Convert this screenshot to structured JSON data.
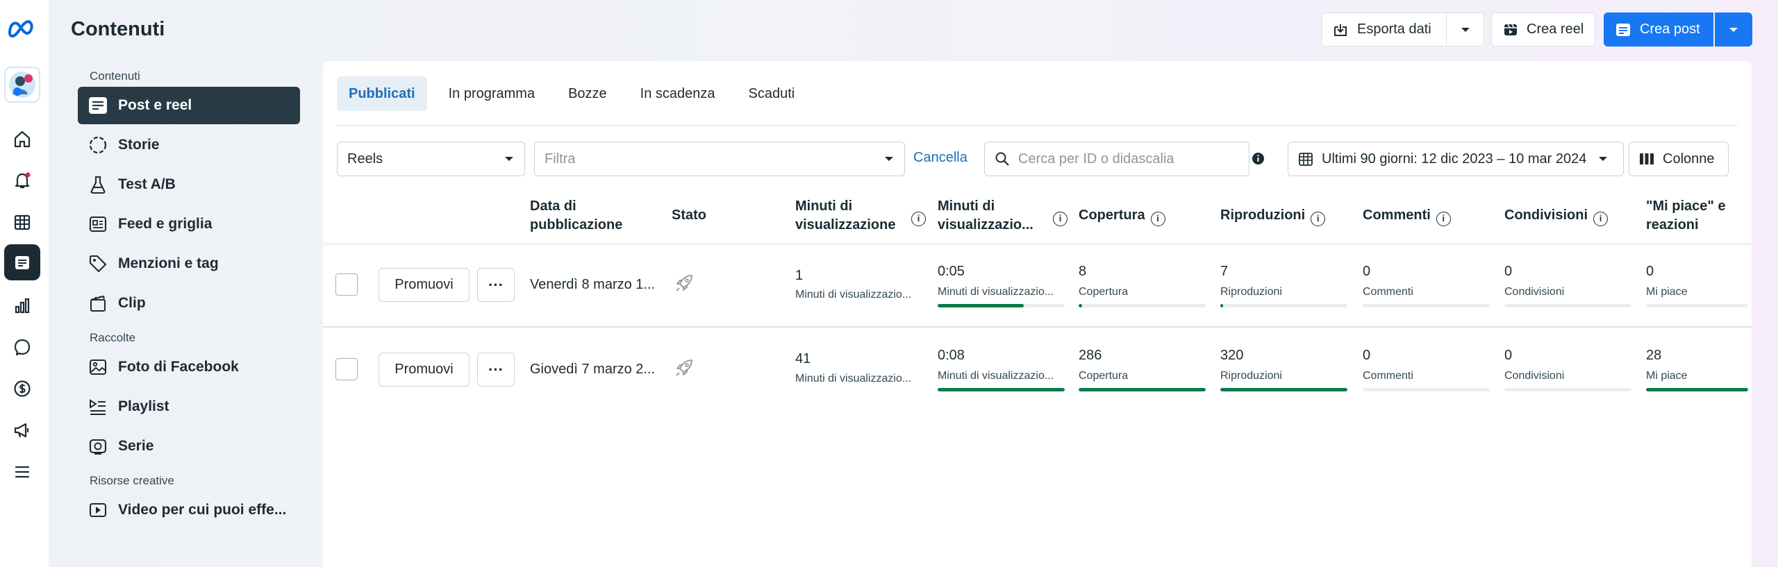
{
  "header": {
    "title": "Contenuti",
    "export_label": "Esporta dati",
    "create_reel_label": "Crea reel",
    "create_post_label": "Crea post"
  },
  "rail": {
    "items": [
      "home-icon",
      "notifications-icon",
      "calendar-icon",
      "content-icon",
      "insights-icon",
      "inbox-icon",
      "monetization-icon",
      "ads-icon",
      "menu-icon"
    ],
    "active": "content-icon",
    "notification_dot_color": "#e41e3f"
  },
  "sidebar": {
    "section_content": "Contenuti",
    "items": [
      {
        "label": "Post e reel",
        "icon": "posts-icon",
        "active": true
      },
      {
        "label": "Storie",
        "icon": "stories-icon"
      },
      {
        "label": "Test A/B",
        "icon": "flask-icon"
      },
      {
        "label": "Feed e griglia",
        "icon": "feed-icon"
      },
      {
        "label": "Menzioni e tag",
        "icon": "tag-icon"
      },
      {
        "label": "Clip",
        "icon": "clip-icon"
      }
    ],
    "section_collections": "Raccolte",
    "collections": [
      {
        "label": "Foto di Facebook",
        "icon": "photo-icon"
      },
      {
        "label": "Playlist",
        "icon": "playlist-icon"
      },
      {
        "label": "Serie",
        "icon": "series-icon"
      }
    ],
    "section_creative": "Risorse creative",
    "creative": [
      {
        "label": "Video per cui puoi effe...",
        "icon": "video-icon"
      }
    ]
  },
  "tabs": [
    "Pubblicati",
    "In programma",
    "Bozze",
    "In scadenza",
    "Scaduti"
  ],
  "filters": {
    "type_value": "Reels",
    "filter_placeholder": "Filtra",
    "cancel_label": "Cancella",
    "search_placeholder": "Cerca per ID o didascalia",
    "date_range": "Ultimi 90 giorni: 12 dic 2023 – 10 mar 2024",
    "columns_label": "Colonne"
  },
  "table": {
    "headers": {
      "date": "Data di pubblicazione",
      "status": "Stato",
      "minutes": "Minuti di visualizzazione",
      "minutes_avg": "Minuti di visualizzazio...",
      "reach": "Copertura",
      "plays": "Riproduzioni",
      "comments": "Commenti",
      "shares": "Condivisioni",
      "likes": "\"Mi piace\" e reazioni"
    },
    "promote_label": "Promuovi",
    "more_label": "···",
    "rows": [
      {
        "date": "Venerdì 8 marzo 1...",
        "minutes": "1",
        "minutes_sub": "Minuti di visualizzazio...",
        "avg": "0:05",
        "avg_sub": "Minuti di visualizzazio...",
        "avg_pct": 68,
        "reach": "8",
        "reach_sub": "Copertura",
        "reach_pct": 3,
        "plays": "7",
        "plays_sub": "Riproduzioni",
        "plays_pct": 2,
        "comments": "0",
        "comments_sub": "Commenti",
        "shares": "0",
        "shares_sub": "Condivisioni",
        "likes": "0",
        "likes_sub": "Mi piace",
        "likes_pct": 0
      },
      {
        "date": "Giovedì 7 marzo 2...",
        "minutes": "41",
        "minutes_sub": "Minuti di visualizzazio...",
        "avg": "0:08",
        "avg_sub": "Minuti di visualizzazio...",
        "avg_pct": 100,
        "reach": "286",
        "reach_sub": "Copertura",
        "reach_pct": 100,
        "plays": "320",
        "plays_sub": "Riproduzioni",
        "plays_pct": 100,
        "comments": "0",
        "comments_sub": "Commenti",
        "shares": "0",
        "shares_sub": "Condivisioni",
        "likes": "28",
        "likes_sub": "Mi piace",
        "likes_pct": 100
      }
    ]
  },
  "colors": {
    "brand": "#1877f2",
    "progress": "#0a7a4a",
    "active_nav": "#283a45"
  }
}
